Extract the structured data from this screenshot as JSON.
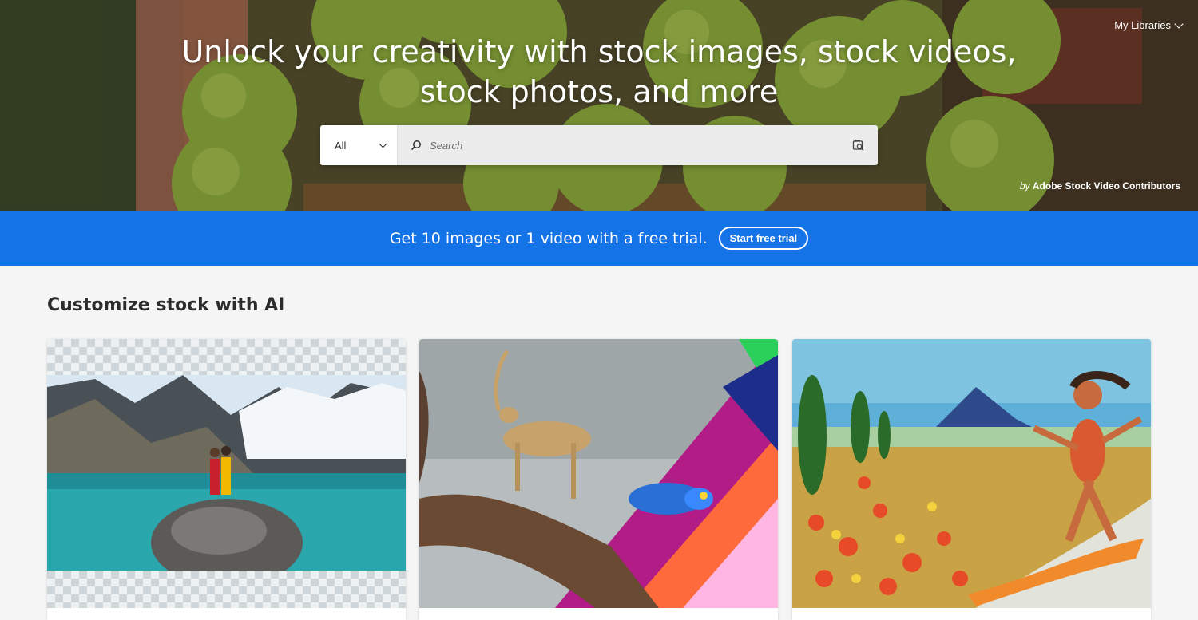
{
  "hero": {
    "title_line1": "Unlock your creativity with stock images, stock videos,",
    "title_line2": "stock photos, and more",
    "my_libraries": "My Libraries",
    "credit_by": "by",
    "credit_name": "Adobe Stock Video Contributors",
    "background_icon": "green-apples-image"
  },
  "search": {
    "filter_value": "All",
    "placeholder": "Search",
    "search_icon": "magnifier-icon",
    "visual_search_icon": "visual-search-icon"
  },
  "banner": {
    "text": "Get 10 images or 1 video with a free trial.",
    "button": "Start free trial",
    "color": "#1473e6"
  },
  "section": {
    "title": "Customize stock with AI",
    "cards": [
      {
        "image": "mountain-lake-couple-generative-expand"
      },
      {
        "image": "cheetah-chameleon-generative-fill"
      },
      {
        "image": "painted-surfer-flower-field"
      }
    ]
  }
}
